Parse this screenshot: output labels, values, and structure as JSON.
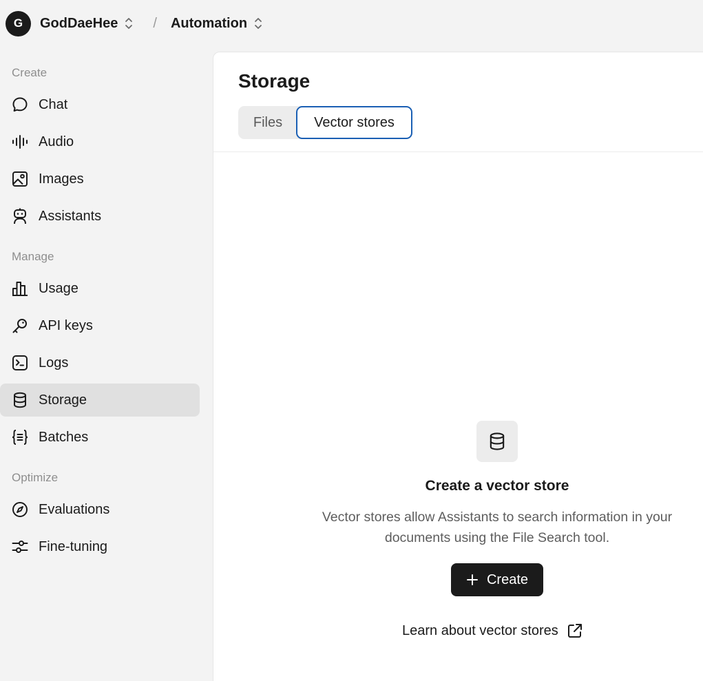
{
  "header": {
    "avatar_letter": "G",
    "org_name": "GodDaeHee",
    "separator": "/",
    "project_name": "Automation"
  },
  "sidebar": {
    "sections": {
      "create": "Create",
      "manage": "Manage",
      "optimize": "Optimize"
    },
    "items": [
      {
        "label": "Chat",
        "icon": "chat-bubble-icon"
      },
      {
        "label": "Audio",
        "icon": "audio-waveform-icon"
      },
      {
        "label": "Images",
        "icon": "image-icon"
      },
      {
        "label": "Assistants",
        "icon": "robot-icon"
      },
      {
        "label": "Usage",
        "icon": "bar-chart-icon"
      },
      {
        "label": "API keys",
        "icon": "key-icon"
      },
      {
        "label": "Logs",
        "icon": "terminal-icon"
      },
      {
        "label": "Storage",
        "icon": "database-icon",
        "active": true
      },
      {
        "label": "Batches",
        "icon": "curly-braces-icon"
      },
      {
        "label": "Evaluations",
        "icon": "compass-icon"
      },
      {
        "label": "Fine-tuning",
        "icon": "sliders-icon"
      }
    ]
  },
  "main": {
    "title": "Storage",
    "tabs": [
      {
        "label": "Files",
        "selected": false
      },
      {
        "label": "Vector stores",
        "selected": true
      }
    ],
    "empty_state": {
      "icon": "database-icon",
      "title": "Create a vector store",
      "description": "Vector stores allow Assistants to search information in your documents using the File Search tool.",
      "button_label": "Create",
      "link_label": "Learn about vector stores"
    }
  },
  "colors": {
    "active_tab_border": "#1a5fb4",
    "primary_button": "#1b1b1b",
    "sidebar_active": "#e0e0e0"
  }
}
